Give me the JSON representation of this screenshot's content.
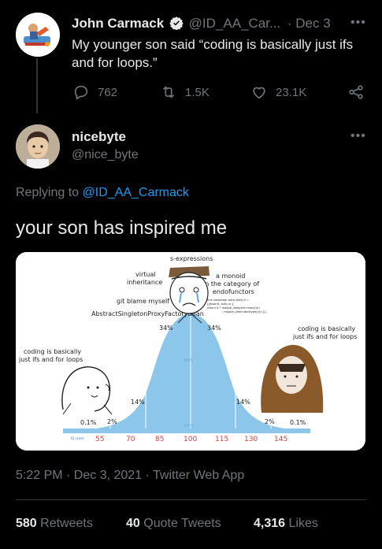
{
  "parent_tweet": {
    "author_name": "John Carmack",
    "author_handle": "@ID_AA_Car...",
    "separator": "·",
    "date": "Dec 3",
    "text": "My younger son said “coding is basically just ifs and for loops.”",
    "replies": "762",
    "retweets": "1.5K",
    "likes": "23.1K"
  },
  "reply_tweet": {
    "author_name": "nicebyte",
    "author_handle": "@nice_byte",
    "replying_prefix": "Replying to",
    "replying_to": "@ID_AA_Carmack",
    "text": "your son has inspired me",
    "timestamp": "5:22 PM · Dec 3, 2021 · Twitter Web App"
  },
  "meme": {
    "top_labels": {
      "s_expressions": "s-expressions",
      "virtual_1": "virtual",
      "virtual_2": "inheritance",
      "monoid_1": "a monoid",
      "monoid_2": "in the category of",
      "monoid_3": "endofunctors",
      "git_blame": "git blame myself",
      "abstract": "AbstractSingletonProxyFactoryBean",
      "code_1": "inline constexpr auto yield_if =",
      "code_2": "[](bool b, auto x) {",
      "code_3": "return b ? maybe_view(std::move(x))",
      "code_4": ": maybe_view<decltype(x)>{};"
    },
    "left_label_1": "coding is basically",
    "left_label_2": "just ifs and for loops",
    "right_label_1": "coding is basically",
    "right_label_2": "just ifs and for loops",
    "percentages": [
      "0.1%",
      "2%",
      "14%",
      "34%",
      "34%",
      "14%",
      "2%",
      "0.1%"
    ],
    "center_faint": "68%",
    "center_faint_2": "95%",
    "iq_label": "IQ score",
    "iq_ticks": [
      "55",
      "70",
      "85",
      "100",
      "115",
      "130",
      "145"
    ]
  },
  "stats": {
    "retweets_count": "580",
    "retweets_label": "Retweets",
    "quotes_count": "40",
    "quotes_label": "Quote Tweets",
    "likes_count": "4,316",
    "likes_label": "Likes"
  },
  "colors": {
    "accent": "#1d9bf0",
    "bell_curve": "#8cc6ea",
    "background": "#000000"
  }
}
